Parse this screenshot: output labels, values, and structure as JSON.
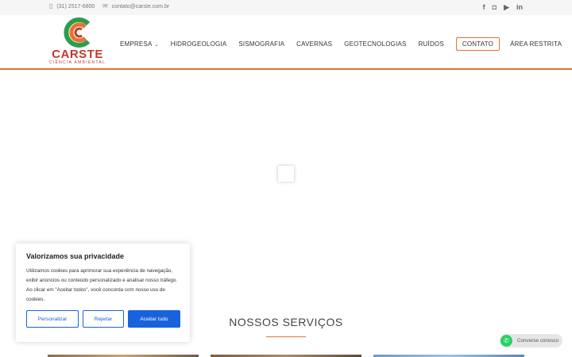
{
  "topbar": {
    "phone": "(31) 2517-6800",
    "email": "contato@carste.com.br",
    "social": [
      {
        "icon": "facebook-icon",
        "glyph": "f"
      },
      {
        "icon": "instagram-icon",
        "glyph": "◘"
      },
      {
        "icon": "youtube-icon",
        "glyph": "▶"
      },
      {
        "icon": "linkedin-icon",
        "glyph": "in"
      }
    ]
  },
  "logo": {
    "brand": "CARSTE",
    "tagline": "CIÊNCIA AMBIENTAL",
    "colors": {
      "green": "#2e9c4e",
      "orange": "#e8732c",
      "red": "#c0392b"
    }
  },
  "nav": {
    "items": [
      {
        "label": "EMPRESA",
        "has_dropdown": true
      },
      {
        "label": "HIDROGEOLOGIA"
      },
      {
        "label": "SISMOGRAFIA"
      },
      {
        "label": "CAVERNAS"
      },
      {
        "label": "GEOTECNOLOGIAS"
      },
      {
        "label": "RUÍDOS"
      },
      {
        "label": "CONTATO",
        "highlighted": true
      },
      {
        "label": "ÁREA RESTRITA"
      }
    ]
  },
  "services": {
    "title": "NOSSOS SERVIÇOS"
  },
  "cookie": {
    "title": "Valorizamos sua privacidade",
    "text": "Utilizamos cookies para aprimorar sua experiência de navegação, exibir anúncios ou conteúdo personalizado e analisar nosso tráfego. Ao clicar em \"Aceitar todos\", você concorda com nosso uso de cookies.",
    "buttons": {
      "customize": "Personalizar",
      "reject": "Rejeitar",
      "accept": "Aceitar tudo"
    }
  },
  "whatsapp": {
    "label": "Converse conosco"
  },
  "theme": {
    "accent": "#e8732c",
    "button_blue": "#1863dc",
    "whatsapp_green": "#25d366"
  }
}
